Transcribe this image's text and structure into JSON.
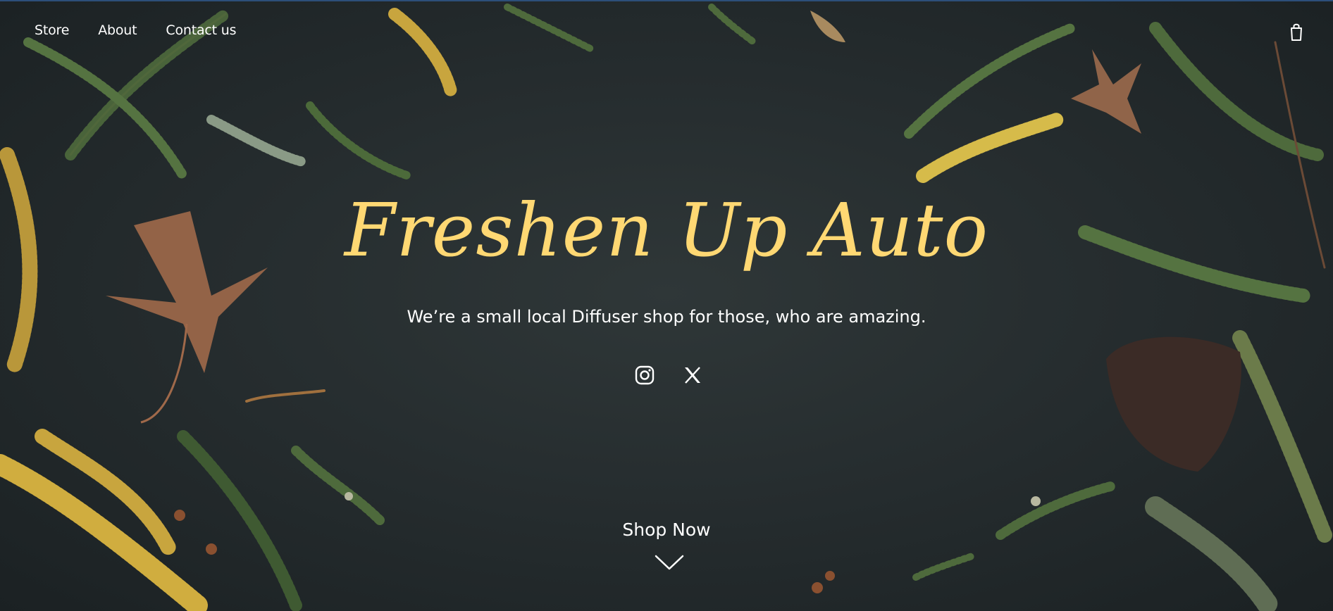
{
  "nav": {
    "items": [
      {
        "label": "Store"
      },
      {
        "label": "About"
      },
      {
        "label": "Contact us"
      }
    ]
  },
  "header": {
    "cart_icon": "shopping-bag-icon"
  },
  "hero": {
    "title": "Freshen Up Auto",
    "tagline": "We’re a small local Diffuser shop for those, who are amazing.",
    "social": [
      {
        "icon": "instagram-icon"
      },
      {
        "icon": "x-twitter-icon"
      }
    ],
    "cta_label": "Shop Now",
    "cta_icon": "chevron-down-icon"
  },
  "colors": {
    "background": "#262d2f",
    "title": "#ffd873",
    "text": "#ffffff",
    "foliage_green": "#4e6a3c",
    "foliage_gold": "#c8a53e",
    "leaf_brown": "#a0694a"
  }
}
